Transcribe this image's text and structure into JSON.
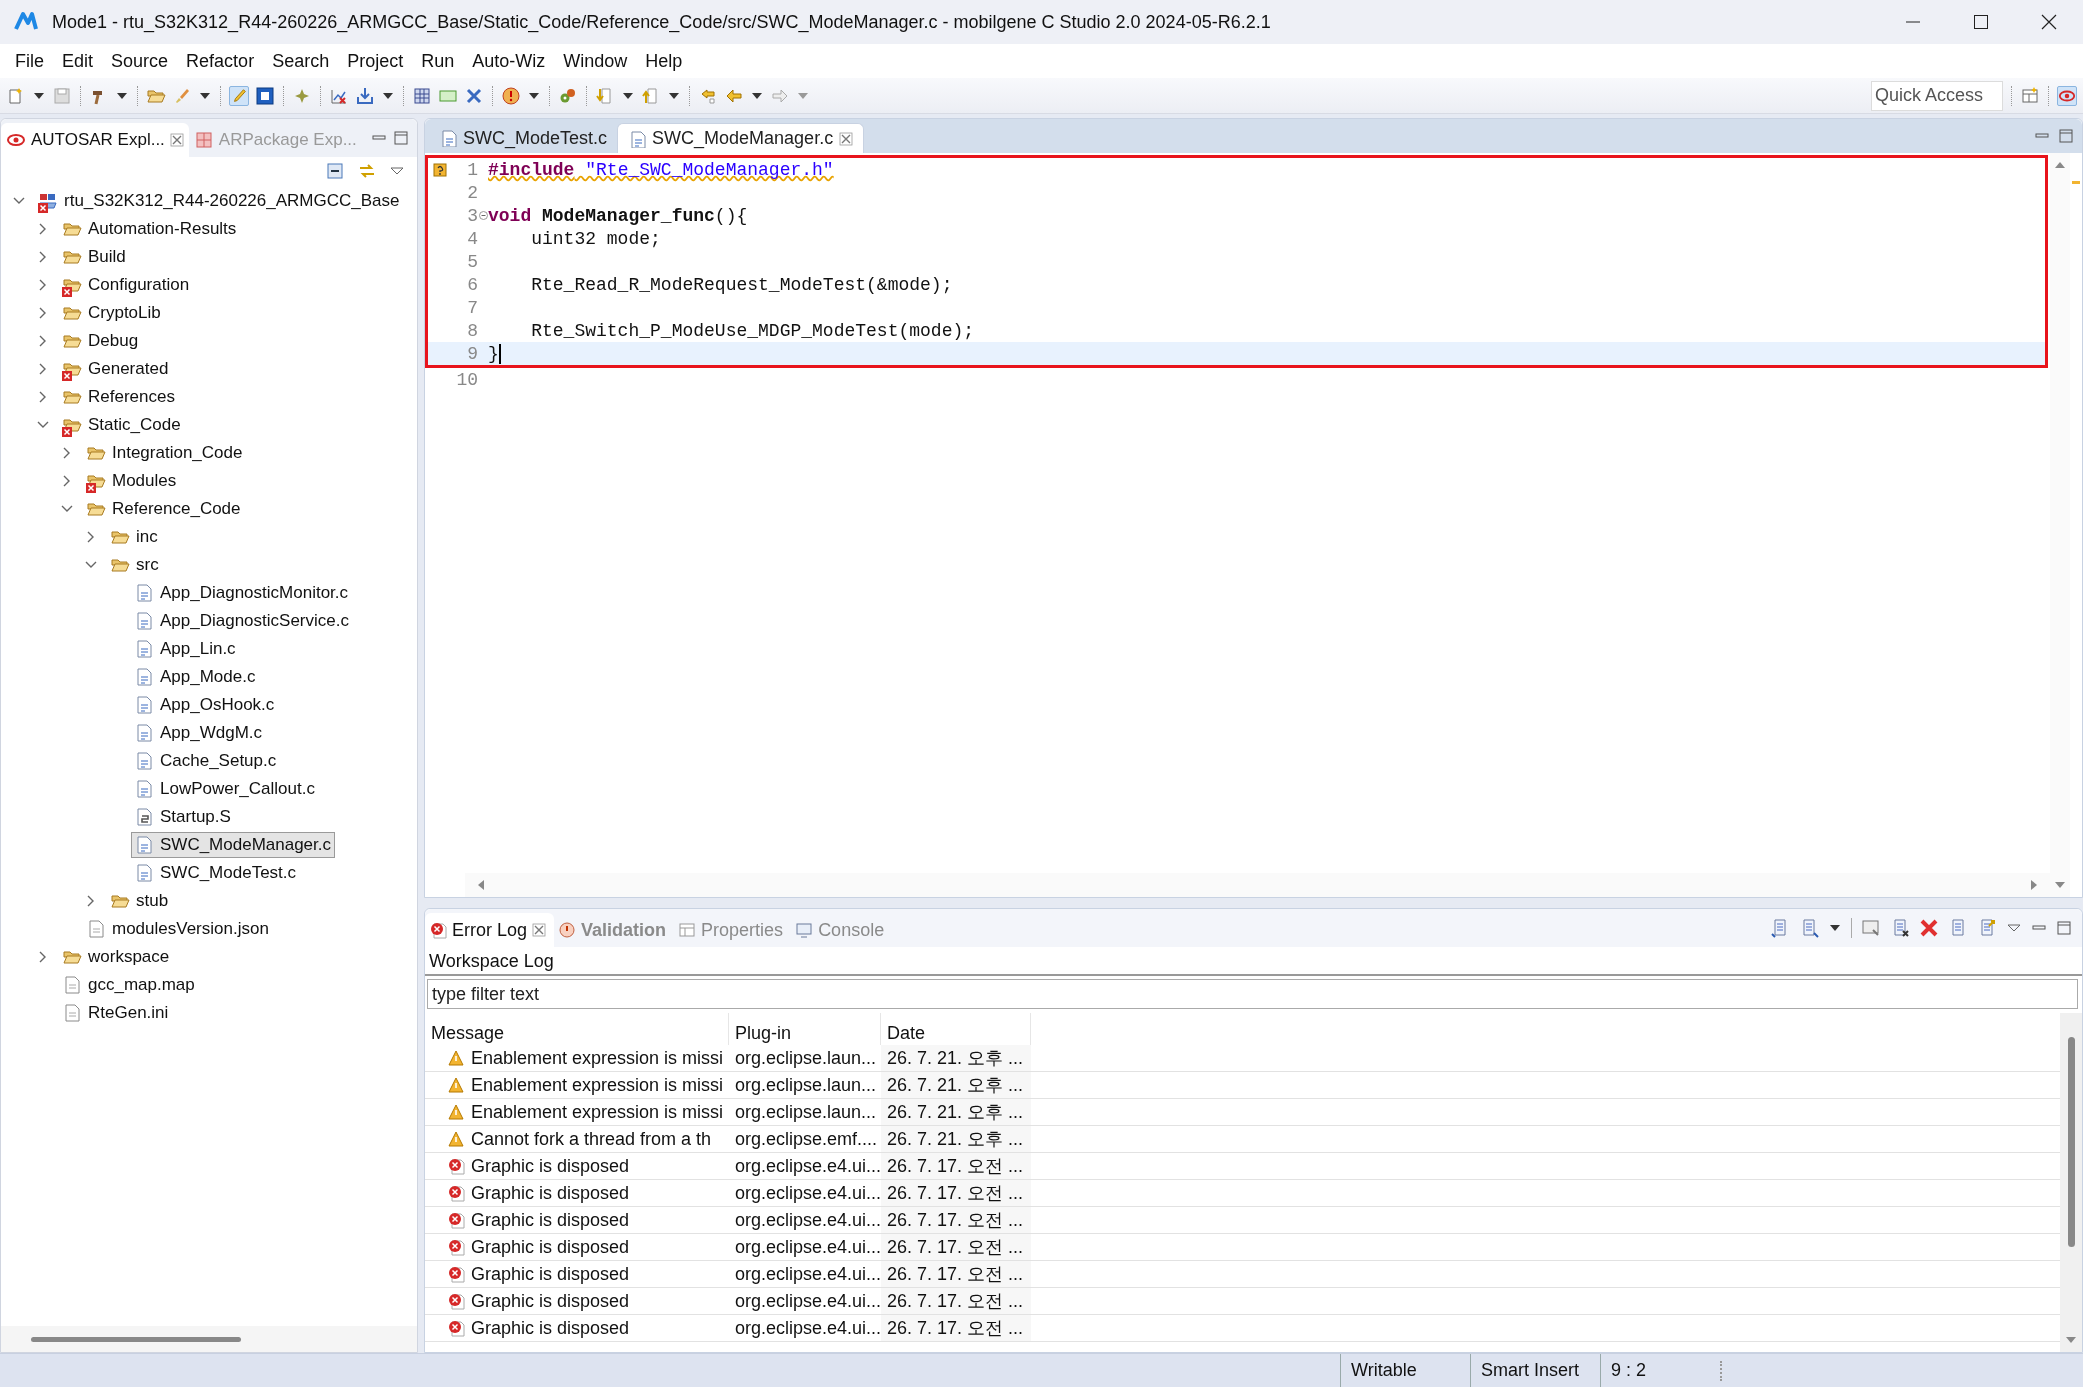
{
  "window": {
    "title": "Mode1 - rtu_S32K312_R44-260226_ARMGCC_Base/Static_Code/Reference_Code/src/SWC_ModeManager.c - mobilgene C Studio 2.0 2024-05-R6.2.1"
  },
  "menu": [
    "File",
    "Edit",
    "Source",
    "Refactor",
    "Search",
    "Project",
    "Run",
    "Auto-Wiz",
    "Window",
    "Help"
  ],
  "quick_access": {
    "placeholder": "Quick Access"
  },
  "explorer": {
    "tabs": [
      {
        "label": "AUTOSAR Expl...",
        "selected": true
      },
      {
        "label": "ARPackage Exp...",
        "selected": false
      }
    ],
    "tree": [
      {
        "label": "rtu_S32K312_R44-260226_ARMGCC_Base",
        "kind": "project",
        "expanded": true,
        "error": true,
        "selected": false,
        "children": [
          {
            "label": "Automation-Results",
            "kind": "folder",
            "expanded": false,
            "error": false,
            "selected": false
          },
          {
            "label": "Build",
            "kind": "folder",
            "expanded": false,
            "error": false,
            "selected": false
          },
          {
            "label": "Configuration",
            "kind": "folder",
            "expanded": false,
            "error": true,
            "selected": false
          },
          {
            "label": "CryptoLib",
            "kind": "folder",
            "expanded": false,
            "error": false,
            "selected": false
          },
          {
            "label": "Debug",
            "kind": "folder",
            "expanded": false,
            "error": false,
            "selected": false
          },
          {
            "label": "Generated",
            "kind": "folder",
            "expanded": false,
            "error": true,
            "selected": false
          },
          {
            "label": "References",
            "kind": "folder",
            "expanded": false,
            "error": false,
            "selected": false
          },
          {
            "label": "Static_Code",
            "kind": "folder",
            "expanded": true,
            "error": true,
            "selected": false,
            "children": [
              {
                "label": "Integration_Code",
                "kind": "folder",
                "expanded": false,
                "error": false,
                "selected": false
              },
              {
                "label": "Modules",
                "kind": "folder",
                "expanded": false,
                "error": true,
                "selected": false
              },
              {
                "label": "Reference_Code",
                "kind": "folder",
                "expanded": true,
                "error": false,
                "selected": false,
                "children": [
                  {
                    "label": "inc",
                    "kind": "folder",
                    "expanded": false,
                    "error": false,
                    "selected": false
                  },
                  {
                    "label": "src",
                    "kind": "folder",
                    "expanded": true,
                    "error": false,
                    "selected": false,
                    "children": [
                      {
                        "label": "App_DiagnosticMonitor.c",
                        "kind": "c_file",
                        "error": false,
                        "selected": false
                      },
                      {
                        "label": "App_DiagnosticService.c",
                        "kind": "c_file",
                        "error": false,
                        "selected": false
                      },
                      {
                        "label": "App_Lin.c",
                        "kind": "c_file",
                        "error": false,
                        "selected": false
                      },
                      {
                        "label": "App_Mode.c",
                        "kind": "c_file",
                        "error": false,
                        "selected": false
                      },
                      {
                        "label": "App_OsHook.c",
                        "kind": "c_file",
                        "error": false,
                        "selected": false
                      },
                      {
                        "label": "App_WdgM.c",
                        "kind": "c_file",
                        "error": false,
                        "selected": false
                      },
                      {
                        "label": "Cache_Setup.c",
                        "kind": "c_file",
                        "error": false,
                        "selected": false
                      },
                      {
                        "label": "LowPower_Callout.c",
                        "kind": "c_file",
                        "error": false,
                        "selected": false
                      },
                      {
                        "label": "Startup.S",
                        "kind": "asm_file",
                        "error": false,
                        "selected": false
                      },
                      {
                        "label": "SWC_ModeManager.c",
                        "kind": "c_file",
                        "error": false,
                        "selected": true
                      },
                      {
                        "label": "SWC_ModeTest.c",
                        "kind": "c_file",
                        "error": false,
                        "selected": false
                      }
                    ]
                  },
                  {
                    "label": "stub",
                    "kind": "folder",
                    "expanded": false,
                    "error": false,
                    "selected": false
                  }
                ]
              },
              {
                "label": "modulesVersion.json",
                "kind": "file",
                "error": false,
                "selected": false
              }
            ]
          },
          {
            "label": "workspace",
            "kind": "folder",
            "expanded": false,
            "error": false,
            "selected": false
          },
          {
            "label": "gcc_map.map",
            "kind": "file",
            "error": false,
            "selected": false
          },
          {
            "label": "RteGen.ini",
            "kind": "file",
            "error": false,
            "selected": false
          }
        ]
      }
    ]
  },
  "editor": {
    "tabs": [
      {
        "label": "SWC_ModeTest.c",
        "selected": false
      },
      {
        "label": "SWC_ModeManager.c",
        "selected": true
      }
    ],
    "blocks": [
      {
        "boxed": true,
        "lines": [
          {
            "number": "1",
            "warning": true,
            "foldable": false,
            "current": false,
            "tokens": [
              {
                "kind": "keyword",
                "text": "#include"
              },
              {
                "kind": "string",
                "text": " \"Rte_SWC_ModeManager.h\""
              }
            ]
          },
          {
            "number": "2",
            "warning": false,
            "foldable": false,
            "current": false
          },
          {
            "number": "3",
            "warning": false,
            "foldable": true,
            "current": false,
            "tokens": [
              {
                "kind": "keyword",
                "text": "void"
              },
              {
                "kind": "function",
                "text": " ModeManager_func"
              },
              {
                "kind": "plain",
                "text": "(){"
              }
            ]
          },
          {
            "number": "4",
            "warning": false,
            "foldable": false,
            "current": false,
            "tokens": [
              {
                "kind": "plain",
                "text": "    uint32 mode;"
              }
            ]
          },
          {
            "number": "5",
            "warning": false,
            "foldable": false,
            "current": false
          },
          {
            "number": "6",
            "warning": false,
            "foldable": false,
            "current": false,
            "tokens": [
              {
                "kind": "plain",
                "text": "    Rte_Read_R_ModeRequest_ModeTest(&mode);"
              }
            ]
          },
          {
            "number": "7",
            "warning": false,
            "foldable": false,
            "current": false
          },
          {
            "number": "8",
            "warning": false,
            "foldable": false,
            "current": false,
            "tokens": [
              {
                "kind": "plain",
                "text": "    Rte_Switch_P_ModeUse_MDGP_ModeTest(mode);"
              }
            ]
          },
          {
            "number": "9",
            "warning": false,
            "foldable": false,
            "current": true,
            "tokens": [
              {
                "kind": "plain",
                "text": "}"
              }
            ]
          }
        ]
      },
      {
        "boxed": false,
        "lines": [
          {
            "number": "10",
            "warning": false,
            "foldable": false,
            "current": false
          }
        ]
      }
    ]
  },
  "log": {
    "tabs": [
      {
        "label": "Error Log",
        "kind": "error_log",
        "selected": true,
        "updated": false
      },
      {
        "label": "Validation",
        "kind": "validation",
        "selected": false,
        "updated": true
      },
      {
        "label": "Properties",
        "kind": "properties",
        "selected": false,
        "updated": false
      },
      {
        "label": "Console",
        "kind": "console",
        "selected": false,
        "updated": false
      }
    ],
    "title": "Workspace Log",
    "filter": {
      "placeholder": "type filter text"
    },
    "columns": [
      "Message",
      "Plug-in",
      "Date"
    ],
    "rows": [
      {
        "kind": "warning",
        "message": "Enablement expression is missi",
        "plugin": "org.eclipse.laun...",
        "date": "26. 7. 21. 오후 ..."
      },
      {
        "kind": "warning",
        "message": "Enablement expression is missi",
        "plugin": "org.eclipse.laun...",
        "date": "26. 7. 21. 오후 ..."
      },
      {
        "kind": "warning",
        "message": "Enablement expression is missi",
        "plugin": "org.eclipse.laun...",
        "date": "26. 7. 21. 오후 ..."
      },
      {
        "kind": "warning",
        "message": "Cannot fork a thread from a th",
        "plugin": "org.eclipse.emf....",
        "date": "26. 7. 21. 오후 ..."
      },
      {
        "kind": "error",
        "message": "Graphic is disposed",
        "plugin": "org.eclipse.e4.ui...",
        "date": "26. 7. 17. 오전 ..."
      },
      {
        "kind": "error",
        "message": "Graphic is disposed",
        "plugin": "org.eclipse.e4.ui...",
        "date": "26. 7. 17. 오전 ..."
      },
      {
        "kind": "error",
        "message": "Graphic is disposed",
        "plugin": "org.eclipse.e4.ui...",
        "date": "26. 7. 17. 오전 ..."
      },
      {
        "kind": "error",
        "message": "Graphic is disposed",
        "plugin": "org.eclipse.e4.ui...",
        "date": "26. 7. 17. 오전 ..."
      },
      {
        "kind": "error",
        "message": "Graphic is disposed",
        "plugin": "org.eclipse.e4.ui...",
        "date": "26. 7. 17. 오전 ..."
      },
      {
        "kind": "error",
        "message": "Graphic is disposed",
        "plugin": "org.eclipse.e4.ui...",
        "date": "26. 7. 17. 오전 ..."
      },
      {
        "kind": "error",
        "message": "Graphic is disposed",
        "plugin": "org.eclipse.e4.ui...",
        "date": "26. 7. 17. 오전 ..."
      }
    ]
  },
  "status_bar": {
    "items": [
      "Writable",
      "Smart Insert",
      "9 : 2"
    ]
  }
}
